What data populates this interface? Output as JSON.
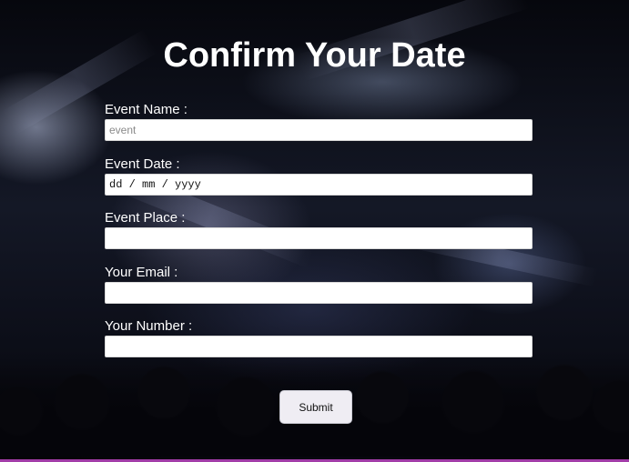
{
  "page": {
    "title": "Confirm Your Date"
  },
  "form": {
    "fields": [
      {
        "label": "Event Name :",
        "placeholder": "event",
        "value": ""
      },
      {
        "label": "Event Date :",
        "placeholder": "dd / mm / yyyy",
        "value": "dd / mm / yyyy"
      },
      {
        "label": "Event Place :",
        "placeholder": "",
        "value": ""
      },
      {
        "label": "Your Email :",
        "placeholder": "",
        "value": ""
      },
      {
        "label": "Your Number :",
        "placeholder": "",
        "value": ""
      }
    ],
    "submit_label": "Submit"
  },
  "colors": {
    "accent_bar": "#a23ca8",
    "title_text": "#ffffff",
    "button_bg": "#efedf3"
  }
}
